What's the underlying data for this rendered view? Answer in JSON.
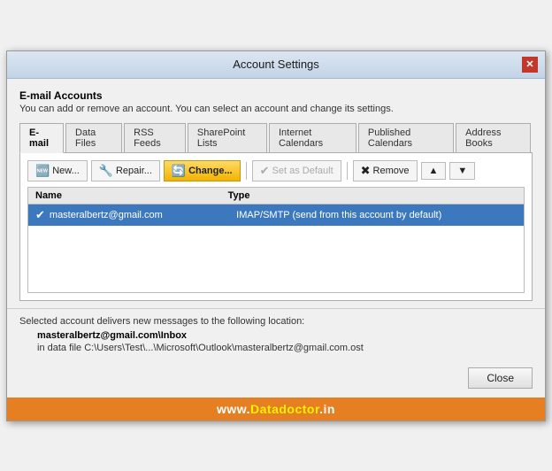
{
  "titleBar": {
    "title": "Account Settings",
    "closeBtn": "✕"
  },
  "sectionHeader": "E-mail Accounts",
  "sectionDesc": "You can add or remove an account. You can select an account and change its settings.",
  "tabs": [
    {
      "id": "email",
      "label": "E-mail",
      "active": true
    },
    {
      "id": "datafiles",
      "label": "Data Files",
      "active": false
    },
    {
      "id": "rssfeeds",
      "label": "RSS Feeds",
      "active": false
    },
    {
      "id": "shareplointlists",
      "label": "SharePoint Lists",
      "active": false
    },
    {
      "id": "internetcalendars",
      "label": "Internet Calendars",
      "active": false
    },
    {
      "id": "publishedcalendars",
      "label": "Published Calendars",
      "active": false
    },
    {
      "id": "addressbooks",
      "label": "Address Books",
      "active": false
    }
  ],
  "toolbar": {
    "newBtn": "New...",
    "repairBtn": "Repair...",
    "changeBtn": "Change...",
    "setDefaultBtn": "Set as Default",
    "removeBtn": "Remove",
    "upBtn": "▲",
    "downBtn": "▼"
  },
  "tableHeaders": {
    "name": "Name",
    "type": "Type"
  },
  "accounts": [
    {
      "name": "masteralbertz@gmail.com",
      "type": "IMAP/SMTP (send from this account by default)",
      "selected": true,
      "icon": "✔"
    }
  ],
  "footerDesc": "Selected account delivers new messages to the following location:",
  "footerPathBold": "masteralbertz@gmail.com\\Inbox",
  "footerPathNormal": "in data file C:\\Users\\Test\\...\\Microsoft\\Outlook\\masteralbertz@gmail.com.ost",
  "closeBtn": "Close",
  "watermark": {
    "prefix": "www.",
    "domain": "Datadoctor",
    "suffix": ".in"
  }
}
